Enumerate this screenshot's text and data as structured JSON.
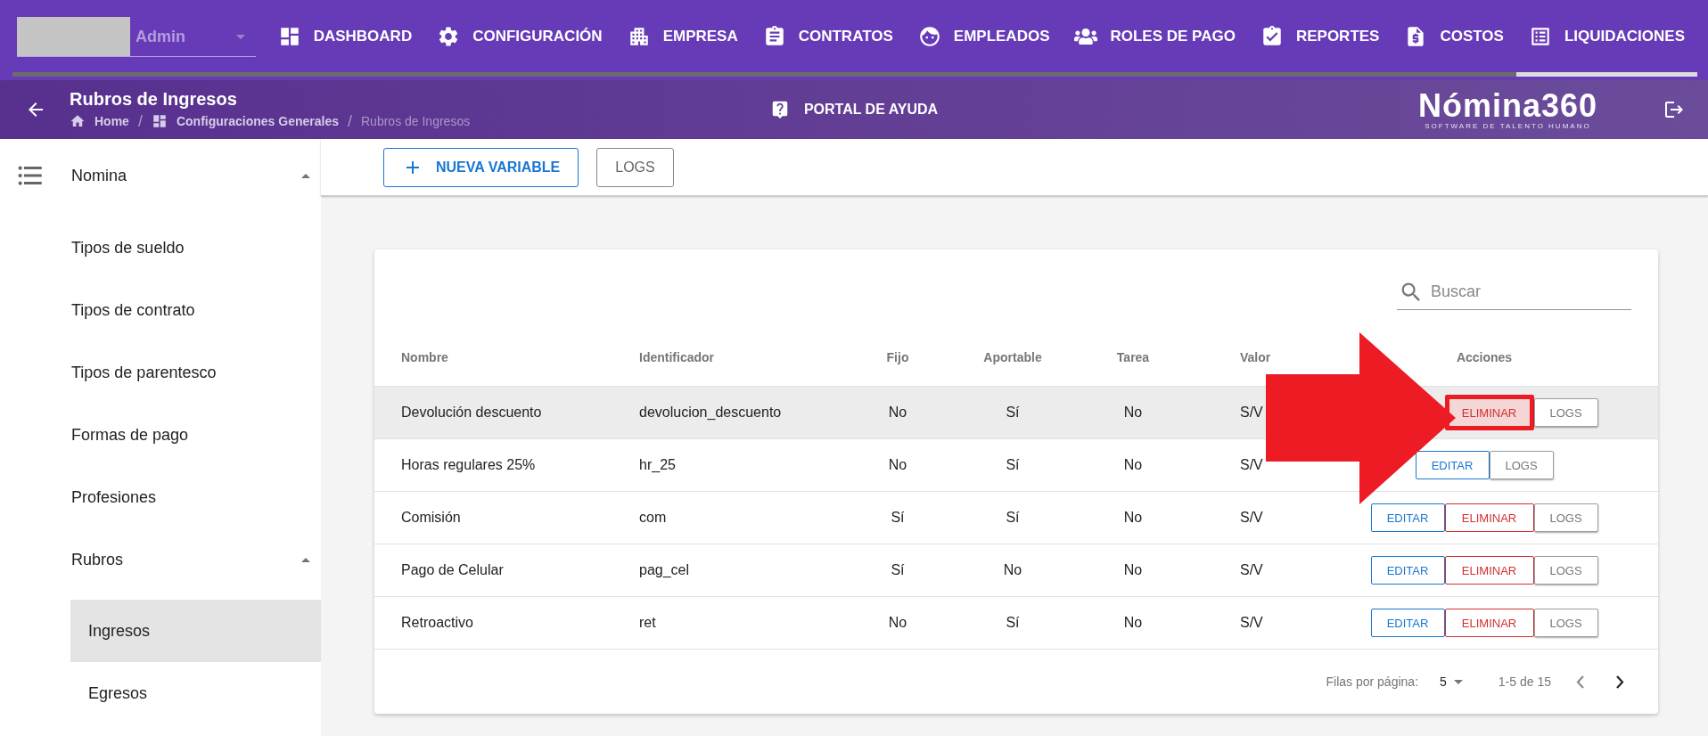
{
  "user": {
    "name": "Admin"
  },
  "nav": [
    {
      "label": "DASHBOARD",
      "selected": false
    },
    {
      "label": "CONFIGURACIÓN",
      "selected": false
    },
    {
      "label": "EMPRESA",
      "selected": false
    },
    {
      "label": "CONTRATOS",
      "selected": false
    },
    {
      "label": "EMPLEADOS",
      "selected": false
    },
    {
      "label": "ROLES DE PAGO",
      "selected": false
    },
    {
      "label": "REPORTES",
      "selected": false
    },
    {
      "label": "COSTOS",
      "selected": false
    },
    {
      "label": "LIQUIDACIONES",
      "selected": true
    }
  ],
  "header": {
    "title": "Rubros de Ingresos",
    "separator": "/",
    "breadcrumb": [
      {
        "label": "Home",
        "current": false
      },
      {
        "label": "Configuraciones Generales",
        "current": false
      },
      {
        "label": "Rubros de Ingresos",
        "current": true
      }
    ],
    "help_link": "PORTAL DE AYUDA",
    "logo": {
      "name": "Nómina360",
      "tagline": "SOFTWARE DE TALENTO HUMANO"
    }
  },
  "sidebar": {
    "items": [
      {
        "label": "Nomina",
        "expanded": true,
        "children": [
          {
            "label": "Tipos de sueldo",
            "selected": false
          },
          {
            "label": "Tipos de contrato",
            "selected": false
          },
          {
            "label": "Tipos de parentesco",
            "selected": false
          },
          {
            "label": "Formas de pago",
            "selected": false
          },
          {
            "label": "Profesiones",
            "selected": false
          },
          {
            "label": "Rubros",
            "expanded": true,
            "children": [
              {
                "label": "Ingresos",
                "selected": true
              },
              {
                "label": "Egresos",
                "selected": false
              }
            ]
          }
        ]
      }
    ]
  },
  "toolbar": {
    "buttons": [
      {
        "kind": "add",
        "label": "NUEVA VARIABLE"
      },
      {
        "kind": "plain",
        "label": "LOGS"
      }
    ]
  },
  "table": {
    "search": {
      "placeholder": "Buscar"
    },
    "columns": [
      "Nombre",
      "Identificador",
      "Fijo",
      "Aportable",
      "Tarea",
      "Valor",
      "Acciones"
    ],
    "rows": [
      {
        "hovered": true,
        "cells": [
          "Devolución descuento",
          "devolucion_descuento",
          "No",
          "Sí",
          "No",
          "S/V"
        ],
        "actions": [
          {
            "kind": "delete",
            "label": "ELIMINAR",
            "highlighted": true
          },
          {
            "kind": "logs",
            "label": "LOGS",
            "highlighted": false
          }
        ]
      },
      {
        "hovered": false,
        "cells": [
          "Horas regulares 25%",
          "hr_25",
          "No",
          "Sí",
          "No",
          "S/V"
        ],
        "actions": [
          {
            "kind": "edit",
            "label": "EDITAR",
            "highlighted": false
          },
          {
            "kind": "logs",
            "label": "LOGS",
            "highlighted": false
          }
        ]
      },
      {
        "hovered": false,
        "cells": [
          "Comisión",
          "com",
          "Sí",
          "Sí",
          "No",
          "S/V"
        ],
        "actions": [
          {
            "kind": "edit",
            "label": "EDITAR",
            "highlighted": false
          },
          {
            "kind": "delete",
            "label": "ELIMINAR",
            "highlighted": false
          },
          {
            "kind": "logs",
            "label": "LOGS",
            "highlighted": false
          }
        ]
      },
      {
        "hovered": false,
        "cells": [
          "Pago de Celular",
          "pag_cel",
          "Sí",
          "No",
          "No",
          "S/V"
        ],
        "actions": [
          {
            "kind": "edit",
            "label": "EDITAR",
            "highlighted": false
          },
          {
            "kind": "delete",
            "label": "ELIMINAR",
            "highlighted": false
          },
          {
            "kind": "logs",
            "label": "LOGS",
            "highlighted": false
          }
        ]
      },
      {
        "hovered": false,
        "cells": [
          "Retroactivo",
          "ret",
          "No",
          "Sí",
          "No",
          "S/V"
        ],
        "actions": [
          {
            "kind": "edit",
            "label": "EDITAR",
            "highlighted": false
          },
          {
            "kind": "delete",
            "label": "ELIMINAR",
            "highlighted": false
          },
          {
            "kind": "logs",
            "label": "LOGS",
            "highlighted": false
          }
        ]
      }
    ],
    "pagination": {
      "rows_label": "Filas por página:",
      "rows_per_page": "5",
      "range": "1-5 de 15",
      "prev_disabled": true,
      "next_disabled": false
    }
  }
}
